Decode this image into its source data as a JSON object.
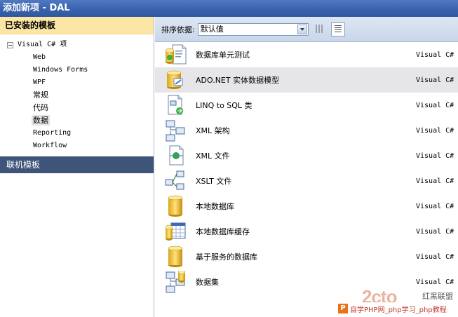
{
  "window": {
    "title": "添加新项 - DAL"
  },
  "left_pane": {
    "installed_header": "已安装的模板",
    "tree_root": "Visual C# 项",
    "tree_items": [
      {
        "label": "Web",
        "selected": false,
        "cjk": false
      },
      {
        "label": "Windows Forms",
        "selected": false,
        "cjk": false
      },
      {
        "label": "WPF",
        "selected": false,
        "cjk": false
      },
      {
        "label": "常规",
        "selected": false,
        "cjk": true
      },
      {
        "label": "代码",
        "selected": false,
        "cjk": true
      },
      {
        "label": "数据",
        "selected": true,
        "cjk": true
      },
      {
        "label": "Reporting",
        "selected": false,
        "cjk": false
      },
      {
        "label": "Workflow",
        "selected": false,
        "cjk": false
      }
    ],
    "online_header": "联机模板"
  },
  "toolbar": {
    "sort_label": "排序依据:",
    "sort_value": "默认值"
  },
  "templates": [
    {
      "name": "数据库单元测试",
      "lang": "Visual C#",
      "icon": "database-unit-test-icon",
      "mono": false,
      "selected": false
    },
    {
      "name": "ADO.NET 实体数据模型",
      "lang": "Visual C#",
      "icon": "entity-data-model-icon",
      "mono": false,
      "selected": true
    },
    {
      "name": "LINQ to SQL 类",
      "lang": "Visual C#",
      "icon": "linq-to-sql-icon",
      "mono": false,
      "selected": false
    },
    {
      "name": "XML 架构",
      "lang": "Visual C#",
      "icon": "xml-schema-icon",
      "mono": false,
      "selected": false
    },
    {
      "name": "XML 文件",
      "lang": "Visual C#",
      "icon": "xml-file-icon",
      "mono": false,
      "selected": false
    },
    {
      "name": "XSLT 文件",
      "lang": "Visual C#",
      "icon": "xslt-file-icon",
      "mono": false,
      "selected": false
    },
    {
      "name": "本地数据库",
      "lang": "Visual C#",
      "icon": "local-database-icon",
      "mono": false,
      "selected": false
    },
    {
      "name": "本地数据库缓存",
      "lang": "Visual C#",
      "icon": "local-database-cache-icon",
      "mono": false,
      "selected": false
    },
    {
      "name": "基于服务的数据库",
      "lang": "Visual C#",
      "icon": "service-database-icon",
      "mono": false,
      "selected": false
    },
    {
      "name": "数据集",
      "lang": "Visual C#",
      "icon": "dataset-icon",
      "mono": false,
      "selected": false
    }
  ],
  "watermark": {
    "logo": "2cto",
    "brand": "红黑联盟",
    "badge": "P",
    "text": "自学PHP网_php学习_php教程"
  }
}
